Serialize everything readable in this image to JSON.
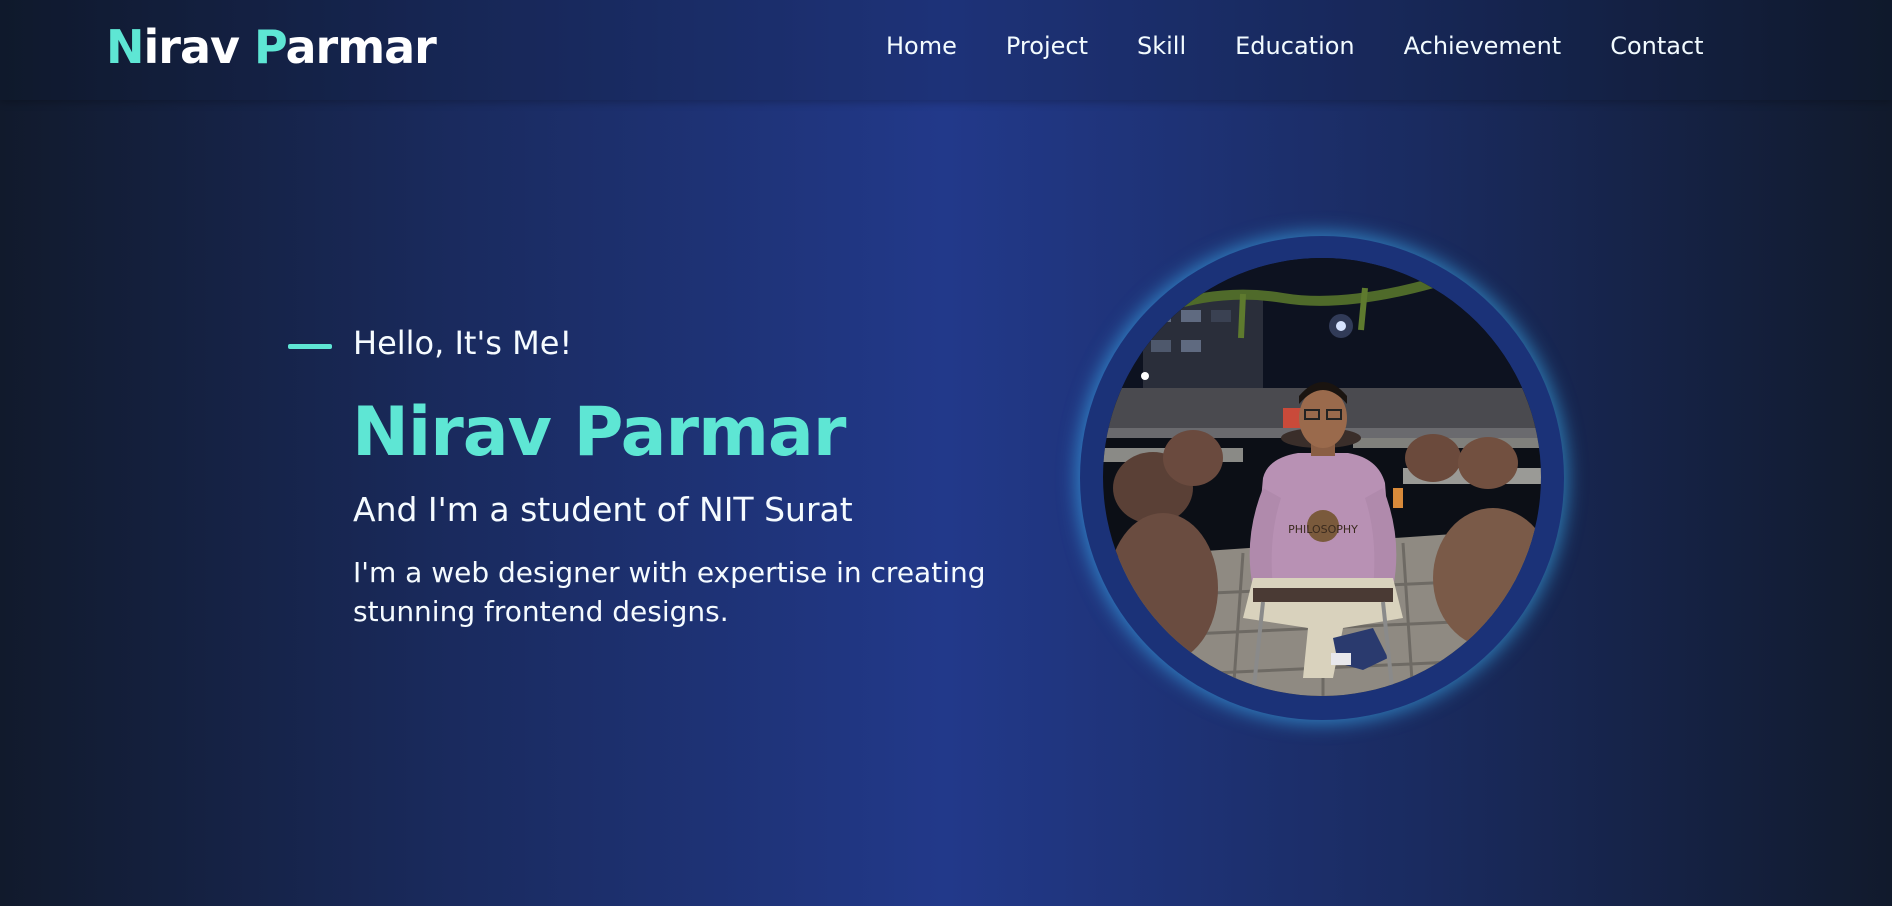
{
  "brand": {
    "first": "N",
    "rest1": "irav ",
    "second": "P",
    "rest2": "armar"
  },
  "nav": [
    {
      "label": "Home"
    },
    {
      "label": "Project"
    },
    {
      "label": "Skill"
    },
    {
      "label": "Education"
    },
    {
      "label": "Achievement"
    },
    {
      "label": "Contact"
    }
  ],
  "hero": {
    "greeting": "Hello, It's Me!",
    "name": "Nirav Parmar",
    "subtitle": "And I'm a student of NIT Surat",
    "description": "I'm a web designer with expertise in creating stunning frontend designs."
  },
  "photo": {
    "shirt_text": "PHILOSOPHY"
  },
  "colors": {
    "accent": "#5ee6d4",
    "bg_center": "#22398a",
    "bg_edge": "#111a2c",
    "ring": "#1b3278",
    "glow": "#40beff"
  }
}
